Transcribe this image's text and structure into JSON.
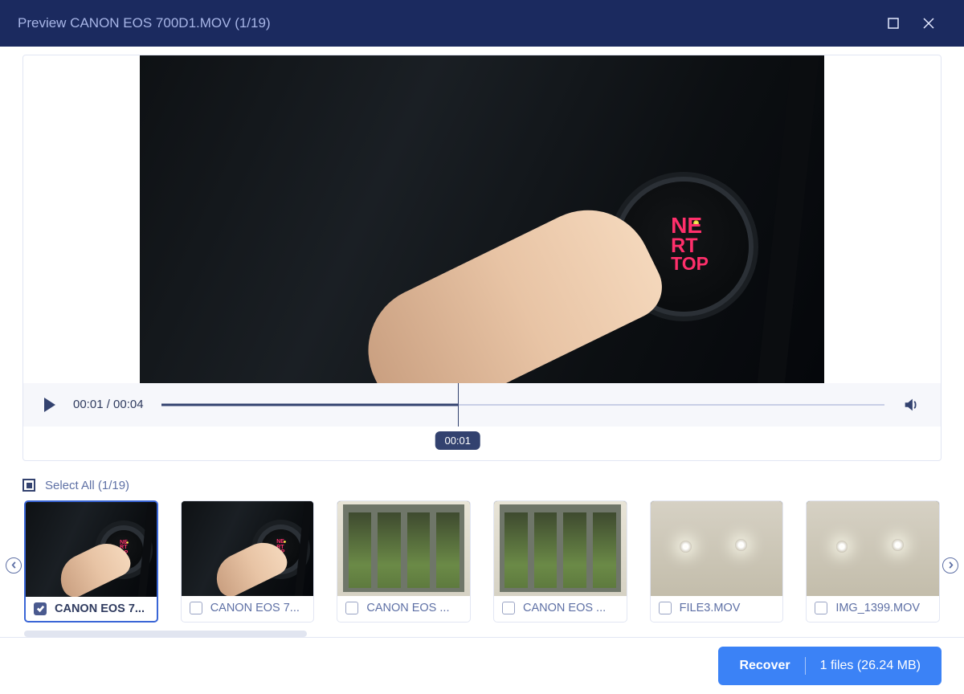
{
  "title": "Preview CANON EOS 700D1.MOV (1/19)",
  "player": {
    "current_time": "00:01",
    "duration": "00:04",
    "timecode_display": "00:01 / 00:04",
    "scrub_label": "00:01",
    "ign_label_line1": "NE",
    "ign_label_line2": "RT",
    "ign_label_line3": "TOP"
  },
  "select_all_label": "Select All (1/19)",
  "thumbnails": [
    {
      "label": "CANON EOS 7...",
      "checked": true,
      "scene": "car",
      "active": true
    },
    {
      "label": "CANON EOS 7...",
      "checked": false,
      "scene": "car",
      "active": false
    },
    {
      "label": "CANON EOS ...",
      "checked": false,
      "scene": "porch",
      "active": false
    },
    {
      "label": "CANON EOS ...",
      "checked": false,
      "scene": "porch",
      "active": false
    },
    {
      "label": "FILE3.MOV",
      "checked": false,
      "scene": "ceiling",
      "active": false
    },
    {
      "label": "IMG_1399.MOV",
      "checked": false,
      "scene": "ceiling",
      "active": false
    }
  ],
  "recover": {
    "button_label": "Recover",
    "info": "1 files (26.24 MB)"
  }
}
